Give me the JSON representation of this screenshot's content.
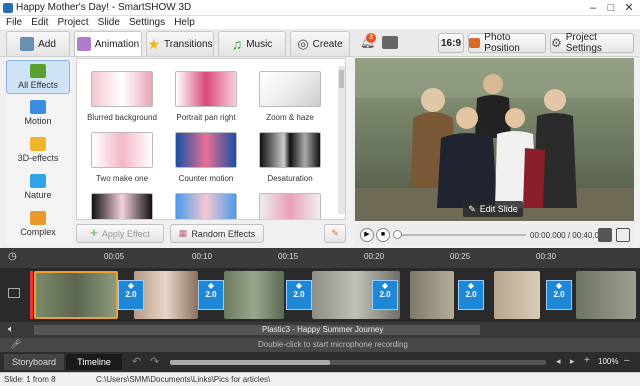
{
  "window": {
    "title": "Happy Mother's Day! - SmartSHOW 3D"
  },
  "menu": [
    "File",
    "Edit",
    "Project",
    "Slide",
    "Settings",
    "Help"
  ],
  "tabs": [
    {
      "label": "Add"
    },
    {
      "label": "Animation"
    },
    {
      "label": "Transitions"
    },
    {
      "label": "Music"
    },
    {
      "label": "Create"
    }
  ],
  "toolbar": {
    "notif_count": "3",
    "aspect": "16:9",
    "photo_position": "Photo Position",
    "project_settings": "Project Settings"
  },
  "categories": [
    {
      "label": "All Effects",
      "active": true,
      "color": "#5aa02c"
    },
    {
      "label": "Motion",
      "active": false,
      "color": "#3a8de0"
    },
    {
      "label": "3D-effects",
      "active": false,
      "color": "#f0b429"
    },
    {
      "label": "Nature",
      "active": false,
      "color": "#2fa4e7"
    },
    {
      "label": "Complex",
      "active": false,
      "color": "#e89b2c"
    }
  ],
  "effects": [
    {
      "label": "Blurred background"
    },
    {
      "label": "Portrait pan right"
    },
    {
      "label": "Zoom & haze"
    },
    {
      "label": "Two make one"
    },
    {
      "label": "Counter motion"
    },
    {
      "label": "Desaturation"
    },
    {
      "label": ""
    },
    {
      "label": ""
    },
    {
      "label": ""
    }
  ],
  "actions": {
    "apply": "Apply Effect",
    "random": "Random Effects"
  },
  "preview": {
    "edit_slide": "Edit Slide",
    "time": "00:00.000 / 00:40.000"
  },
  "ruler": [
    "00:05",
    "00:10",
    "00:15",
    "00:20",
    "00:25",
    "00:30"
  ],
  "transitions": [
    "2.0",
    "2.0",
    "2.0",
    "2.0",
    "2.0",
    "2.0",
    "2.0",
    "2.0"
  ],
  "music": {
    "track": "Plastic3 - Happy Summer Journey",
    "mic_hint": "Double-click to start microphone recording"
  },
  "view_tabs": {
    "storyboard": "Storyboard",
    "timeline": "Timeline"
  },
  "zoom": "100%",
  "status": {
    "slide": "Slide: 1 from 8",
    "path": "C:\\Users\\SMM\\Documents\\Links\\Pics for articles\\"
  },
  "colors": {
    "accent": "#1e88d6",
    "active_tab": "#ffffff",
    "timeline_bg": "#2a2a2a"
  }
}
